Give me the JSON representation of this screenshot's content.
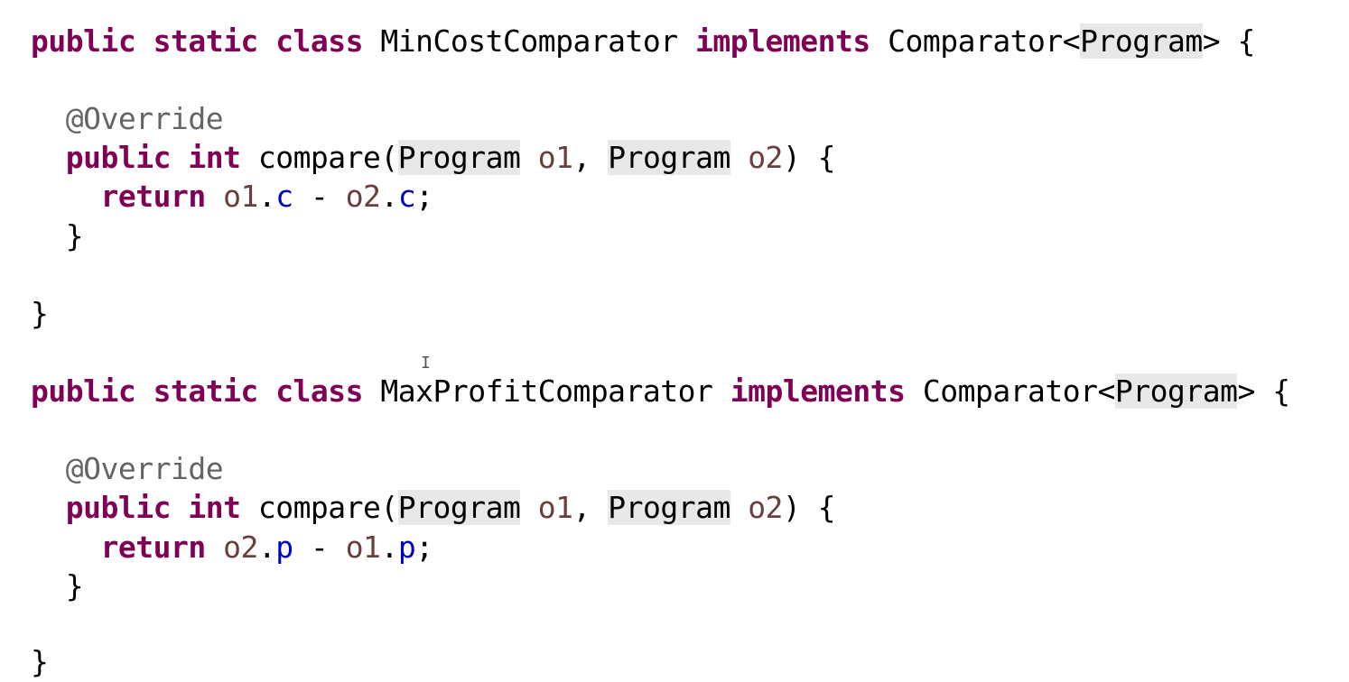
{
  "editor": {
    "cursor_glyph": "I",
    "blocks": [
      {
        "class_header": {
          "kw_public": "public",
          "kw_static": "static",
          "kw_class": "class",
          "class_name": "MinCostComparator",
          "kw_implements": "implements",
          "interface_name": "Comparator<",
          "type_arg": "Program",
          "type_close": "> {"
        },
        "annotation": "@Override",
        "method_header": {
          "kw_public": "public",
          "kw_int": "int",
          "method_name": "compare(",
          "param1_type": "Program",
          "param1_name": "o1",
          "comma": ", ",
          "param2_type": "Program",
          "param2_name": "o2",
          "method_close": ") {"
        },
        "return_line": {
          "kw_return": "return",
          "left_obj": "o1",
          "left_dot": ".",
          "left_field": "c",
          "operator": " - ",
          "right_obj": "o2",
          "right_dot": ".",
          "right_field": "c",
          "semicolon": ";"
        },
        "method_end": "}",
        "class_end": "}"
      },
      {
        "class_header": {
          "kw_public": "public",
          "kw_static": "static",
          "kw_class": "class",
          "class_name": "MaxProfitComparator",
          "kw_implements": "implements",
          "interface_name": "Comparator<",
          "type_arg": "Program",
          "type_close": "> {"
        },
        "annotation": "@Override",
        "method_header": {
          "kw_public": "public",
          "kw_int": "int",
          "method_name": "compare(",
          "param1_type": "Program",
          "param1_name": "o1",
          "comma": ", ",
          "param2_type": "Program",
          "param2_name": "o2",
          "method_close": ") {"
        },
        "return_line": {
          "kw_return": "return",
          "left_obj": "o2",
          "left_dot": ".",
          "left_field": "p",
          "operator": " - ",
          "right_obj": "o1",
          "right_dot": ".",
          "right_field": "p",
          "semicolon": ";"
        },
        "method_end": "}",
        "class_end": "}"
      }
    ],
    "colors": {
      "keyword": "#7f0055",
      "annotation": "#646464",
      "field": "#0000c0",
      "parameter": "#6a3e3e",
      "type_highlight": "#e8e8e8",
      "background": "#ffffff"
    }
  }
}
